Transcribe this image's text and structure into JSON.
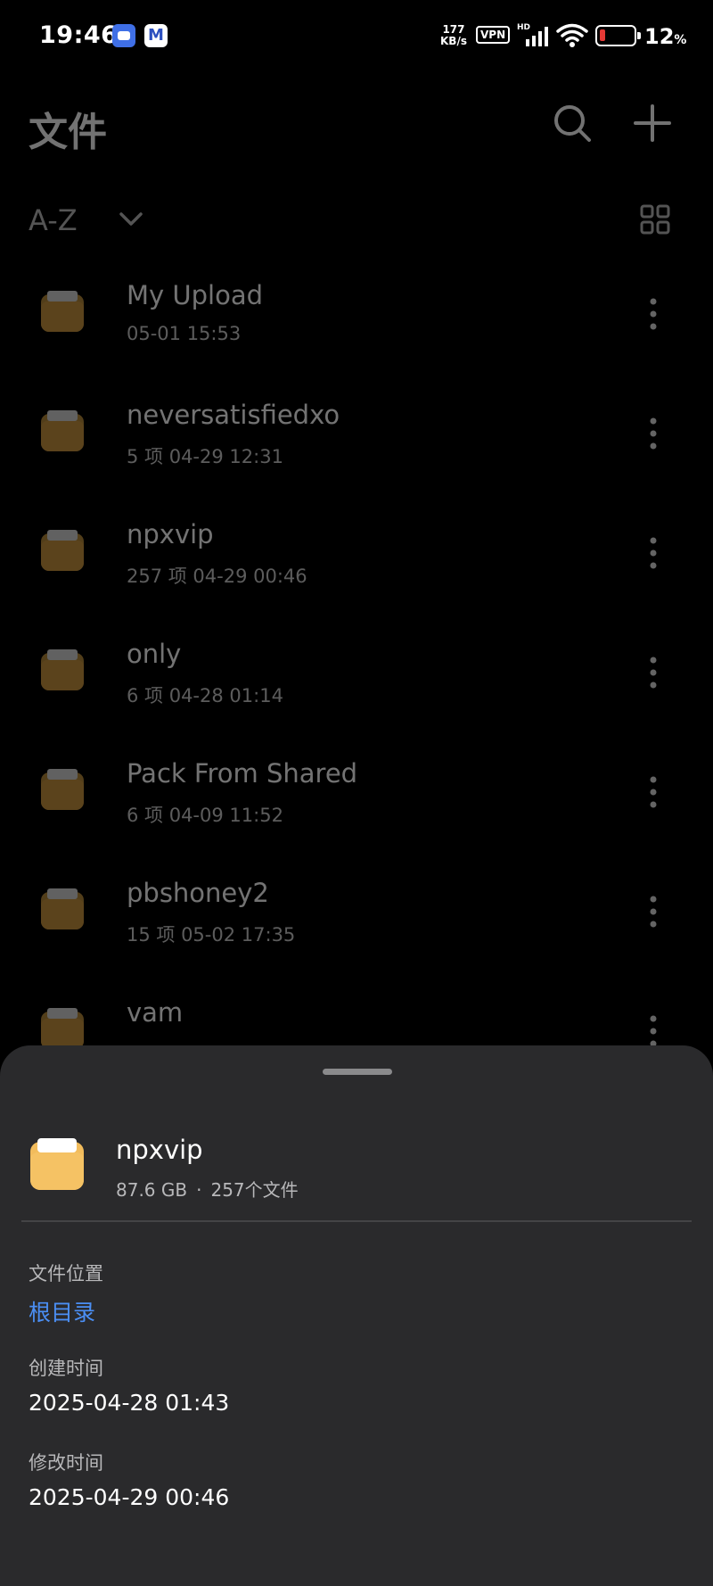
{
  "status_bar": {
    "time": "19:46",
    "net_speed_value": "177",
    "net_speed_unit": "KB/s",
    "vpn": "VPN",
    "signal_tag": "HD",
    "battery_percent": "12",
    "battery_percent_sign": "%",
    "notification_icons": [
      "app-robot-icon",
      "gmail-icon"
    ],
    "badge_2_letter": "M"
  },
  "header": {
    "title": "文件",
    "sort_label": "A-Z",
    "icons": [
      "search-icon",
      "add-icon",
      "grid-view-icon"
    ]
  },
  "files": [
    {
      "name": "My Upload",
      "meta": "05-01 15:53"
    },
    {
      "name": "neversatisfiedxo",
      "meta": "5 项  04-29 12:31"
    },
    {
      "name": "npxvip",
      "meta": "257 项  04-29 00:46"
    },
    {
      "name": "only",
      "meta": "6 项  04-28 01:14"
    },
    {
      "name": "Pack From Shared",
      "meta": "6 项  04-09 11:52"
    },
    {
      "name": "pbshoney2",
      "meta": "15 项  05-02 17:35"
    },
    {
      "name": "vam",
      "meta": ""
    }
  ],
  "sheet": {
    "name": "npxvip",
    "size": "87.6 GB",
    "separator": "·",
    "count": "257个文件",
    "location_label": "文件位置",
    "location_value": "根目录",
    "created_label": "创建时间",
    "created_value": "2025-04-28 01:43",
    "modified_label": "修改时间",
    "modified_value": "2025-04-29 00:46"
  },
  "colors": {
    "background": "#000000",
    "sheet_background": "#2a2a2c",
    "folder": "#c9963f",
    "sheet_folder": "#f5c264",
    "link": "#4b8ff5",
    "battery_low": "#e53935"
  }
}
